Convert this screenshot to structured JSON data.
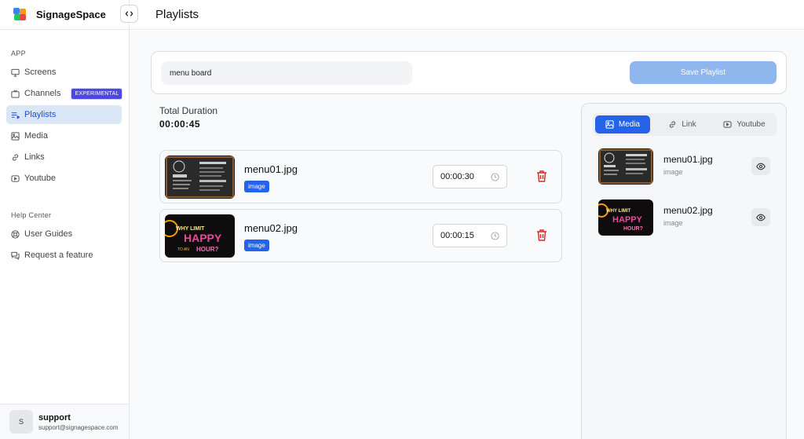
{
  "app": {
    "name": "SignageSpace"
  },
  "header": {
    "title": "Playlists"
  },
  "sidebar": {
    "app_label": "APP",
    "items": [
      {
        "label": "Screens",
        "icon": "monitor-icon"
      },
      {
        "label": "Channels",
        "icon": "tv-icon",
        "badge": "EXPERIMENTAL"
      },
      {
        "label": "Playlists",
        "icon": "playlist-icon",
        "active": true
      },
      {
        "label": "Media",
        "icon": "image-icon"
      },
      {
        "label": "Links",
        "icon": "link-icon"
      },
      {
        "label": "Youtube",
        "icon": "youtube-icon"
      }
    ],
    "help_label": "Help Center",
    "help_items": [
      {
        "label": "User Guides",
        "icon": "lifebuoy-icon"
      },
      {
        "label": "Request a feature",
        "icon": "chat-icon"
      }
    ]
  },
  "user": {
    "initial": "S",
    "name": "support",
    "email": "support@signagespace.com"
  },
  "playlist": {
    "name": "menu board",
    "save_label": "Save Playlist",
    "total_duration_label": "Total Duration",
    "total_duration": "00:00:45",
    "items": [
      {
        "name": "menu01.jpg",
        "type": "image",
        "duration": "00:00:30"
      },
      {
        "name": "menu02.jpg",
        "type": "image",
        "duration": "00:00:15"
      }
    ]
  },
  "library": {
    "tabs": [
      {
        "label": "Media",
        "icon": "image-icon",
        "active": true
      },
      {
        "label": "Link",
        "icon": "link-icon"
      },
      {
        "label": "Youtube",
        "icon": "youtube-icon"
      }
    ],
    "items": [
      {
        "name": "menu01.jpg",
        "type": "image"
      },
      {
        "name": "menu02.jpg",
        "type": "image"
      }
    ]
  },
  "colors": {
    "accent": "#2563eb",
    "save_button": "#8fb7ee",
    "delete": "#dc2626",
    "badge_experimental": "#4f46e5"
  }
}
